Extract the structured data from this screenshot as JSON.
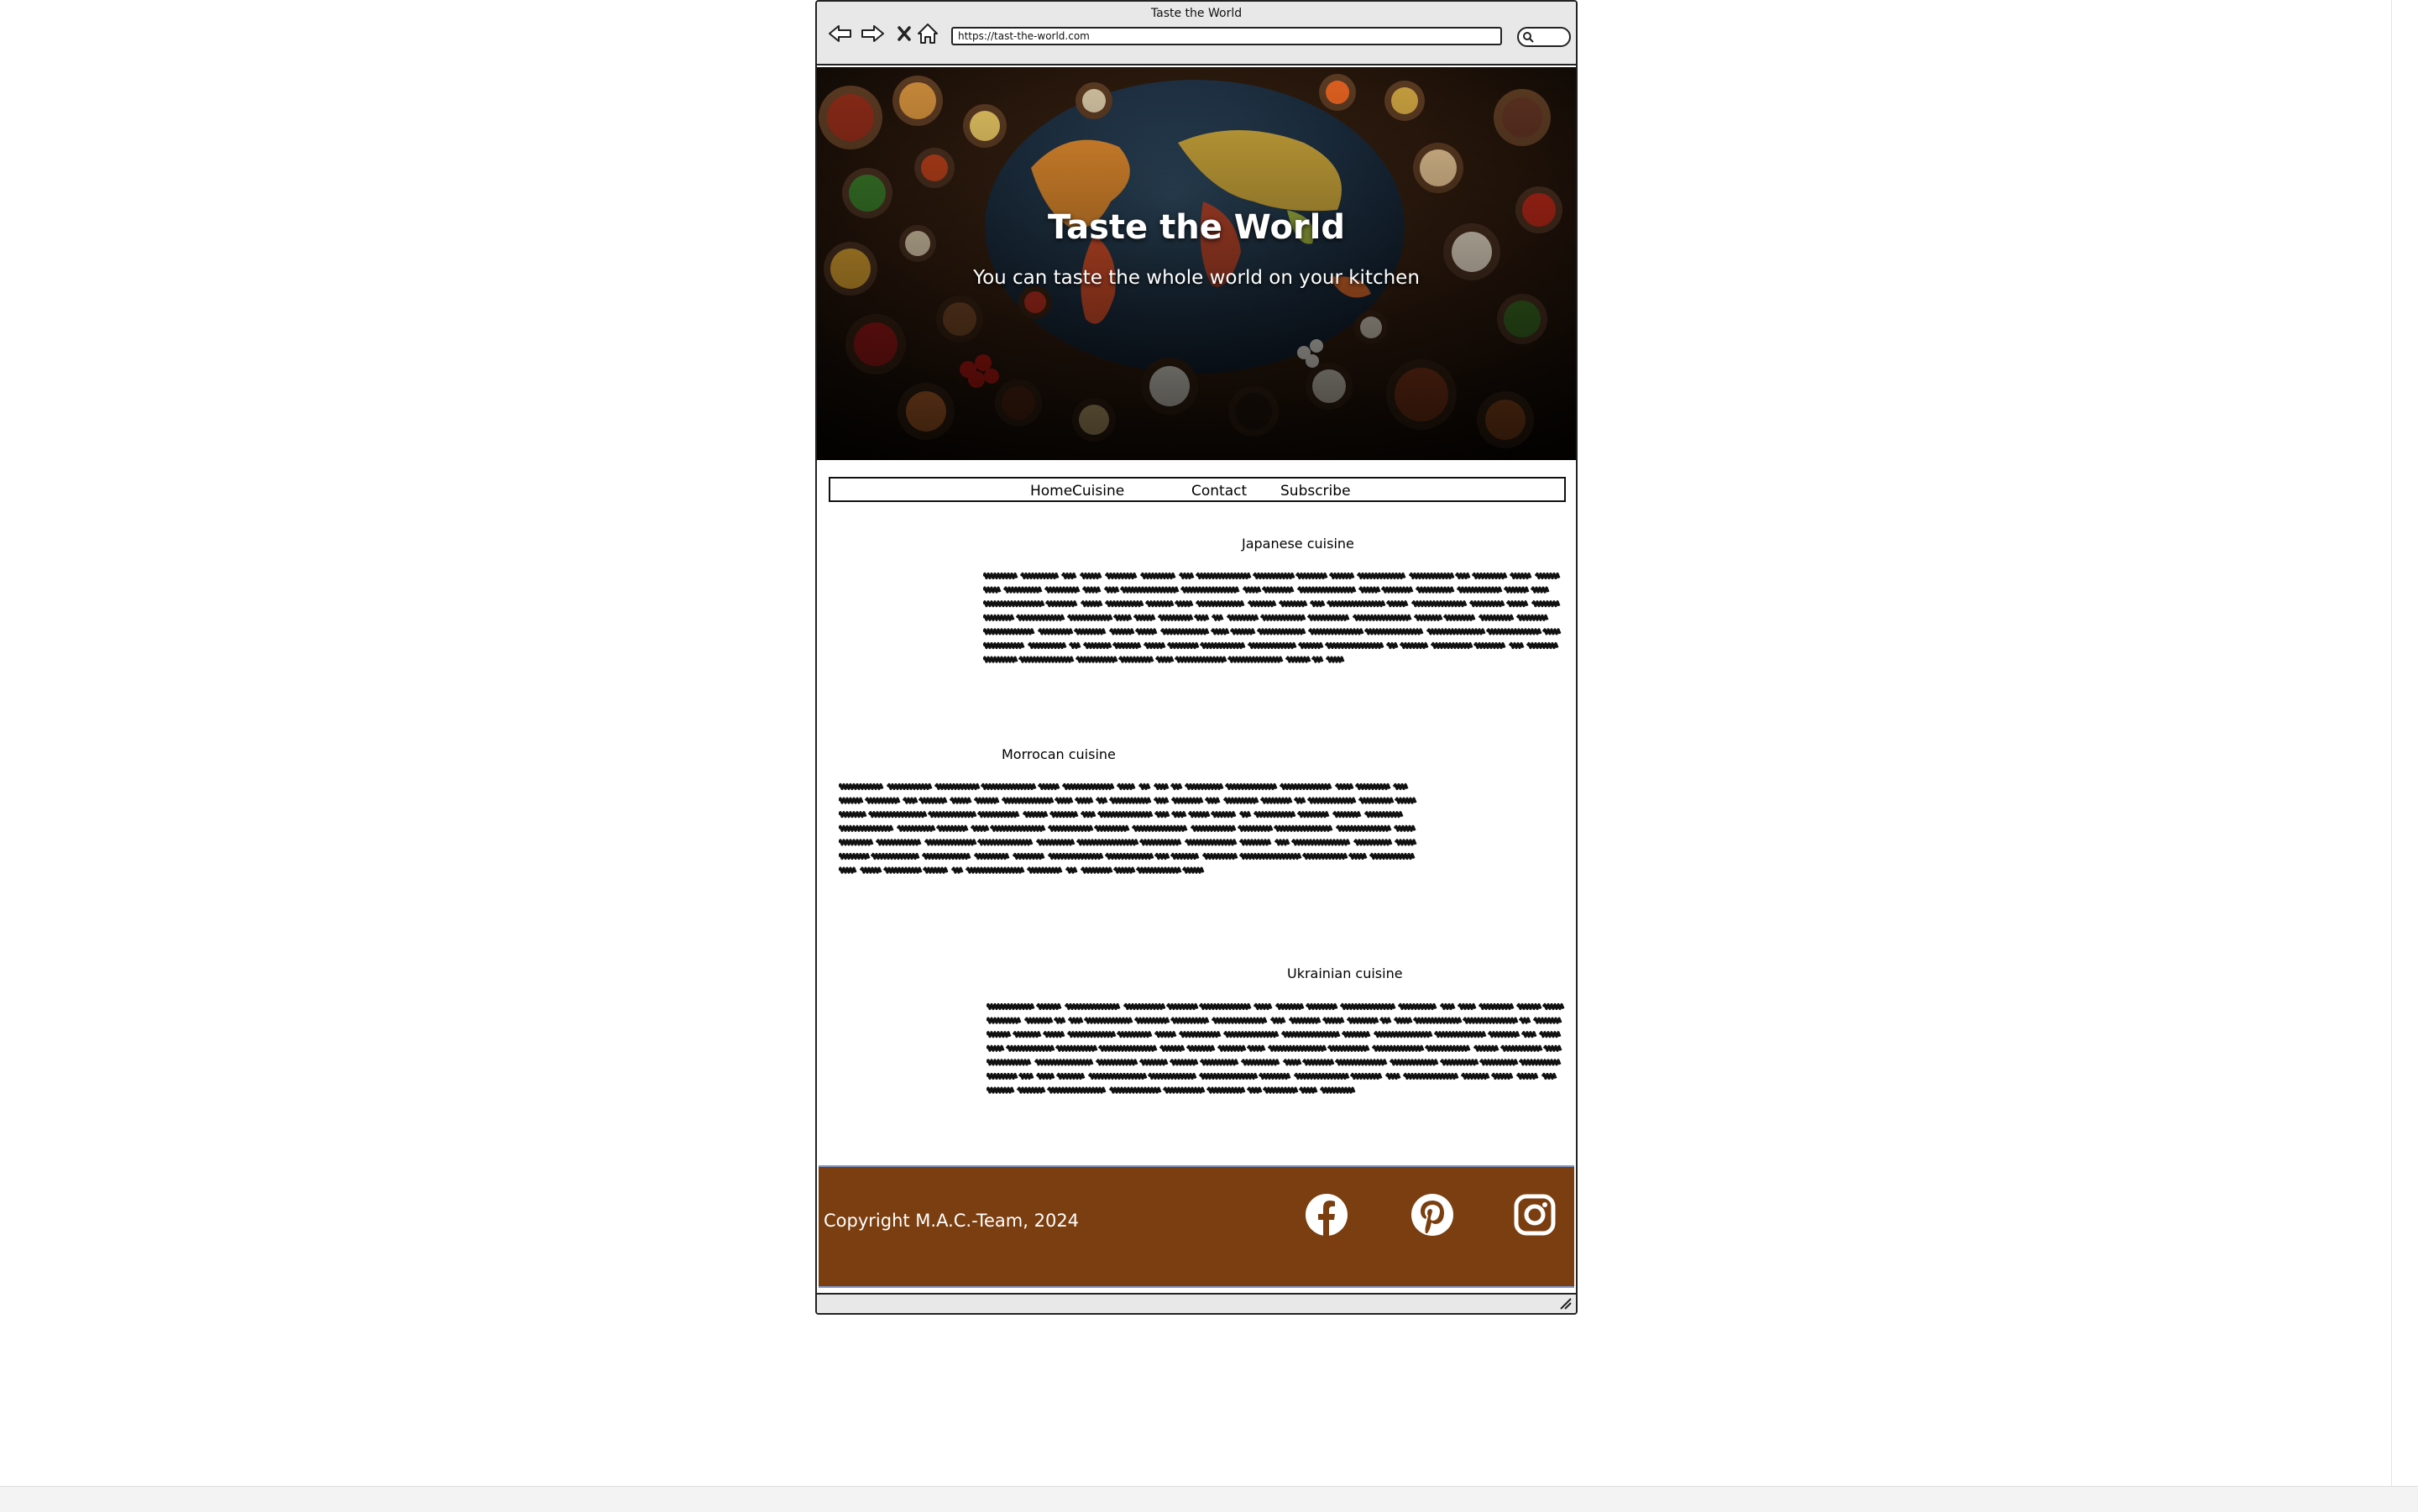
{
  "window": {
    "title": "Taste the World",
    "url": "https://tast-the-world.com"
  },
  "hero": {
    "title": "Taste the World",
    "subtitle": "You can taste the whole world on your kitchen"
  },
  "nav": {
    "items": [
      {
        "label": "Home"
      },
      {
        "label": "Cuisine"
      },
      {
        "label": "Contact"
      },
      {
        "label": "Subscribe"
      }
    ]
  },
  "sections": [
    {
      "title": "Japanese cuisine"
    },
    {
      "title": "Morrocan cuisine"
    },
    {
      "title": "Ukrainian cuisine"
    }
  ],
  "footer": {
    "copyright": "Copyright M.A.C.-Team, 2024",
    "social": [
      {
        "icon": "facebook-icon"
      },
      {
        "icon": "pinterest-icon"
      },
      {
        "icon": "instagram-icon"
      }
    ]
  },
  "colors": {
    "footer_bg": "#7a3e10",
    "footer_border": "#7b95c9",
    "chrome": "#e8e8e8"
  }
}
